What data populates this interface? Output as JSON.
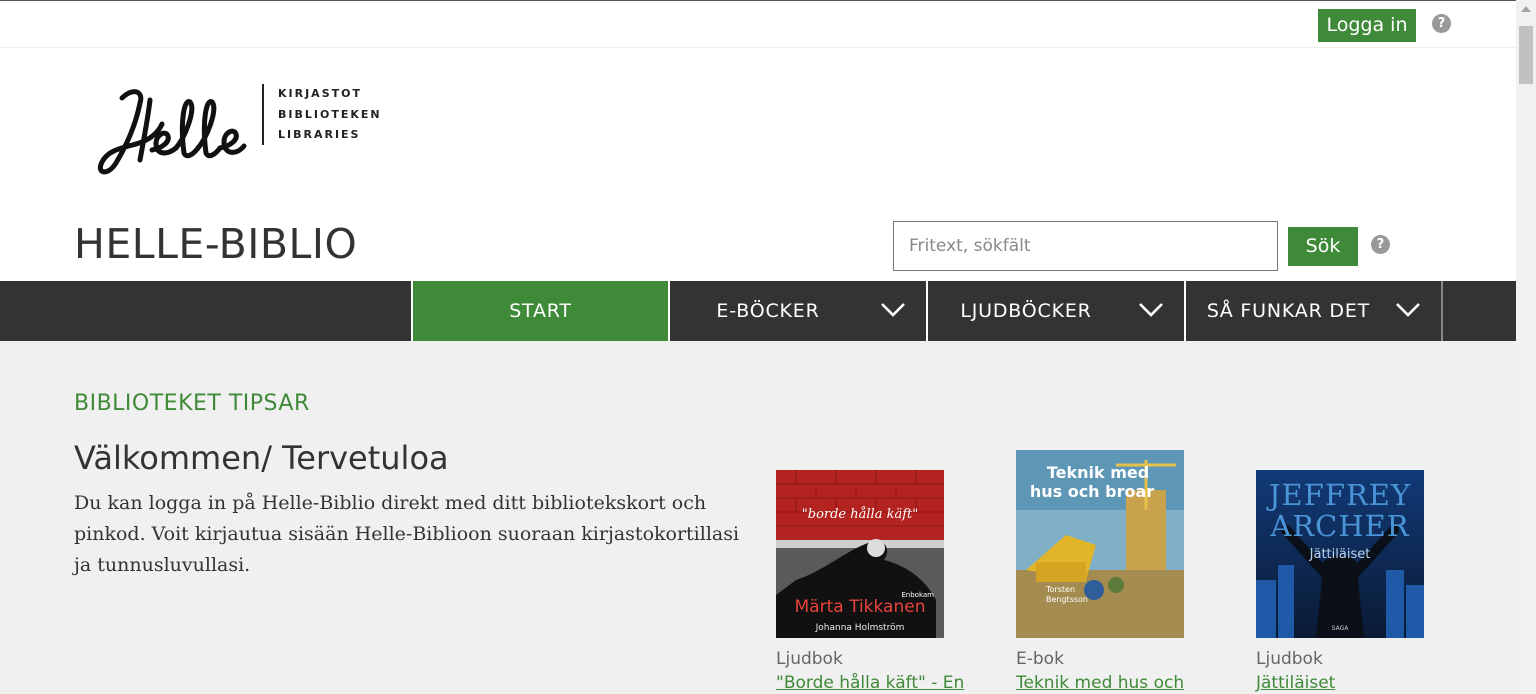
{
  "topbar": {
    "login_label": "Logga in",
    "help_glyph": "?"
  },
  "header": {
    "logo_script": "Helle",
    "logo_lines": [
      "KIRJASTOT",
      "BIBLIOTEKEN",
      "LIBRARIES"
    ],
    "site_title": "HELLE-BIBLIO"
  },
  "search": {
    "placeholder": "Fritext, sökfält",
    "value": "",
    "button_label": "Sök",
    "help_glyph": "?"
  },
  "nav": {
    "items": [
      {
        "label": "START",
        "active": true,
        "dropdown": false
      },
      {
        "label": "E-BÖCKER",
        "active": false,
        "dropdown": true
      },
      {
        "label": "LJUDBÖCKER",
        "active": false,
        "dropdown": true
      },
      {
        "label": "SÅ FUNKAR DET",
        "active": false,
        "dropdown": true
      }
    ]
  },
  "main": {
    "section_title": "BIBLIOTEKET TIPSAR",
    "welcome_title": "Välkommen/ Tervetuloa",
    "welcome_text": "Du kan logga in på Helle-Biblio direkt med ditt bibliotekskort och pinkod. Voit kirjautua sisään Helle-Biblioon suoraan kirjastokortillasi ja tunnusluvullasi."
  },
  "books": [
    {
      "type": "Ljudbok",
      "title": "\"Borde hålla käft\" - En",
      "cover_text": {
        "quote": "\"borde hålla käft\"",
        "subtitle": "Enbokam",
        "author_big": "Märta Tikkanen",
        "author_small": "Johanna Holmström"
      }
    },
    {
      "type": "E-bok",
      "title": "Teknik med hus och",
      "cover_text": {
        "title_line1": "Teknik med",
        "title_line2": "hus och broar",
        "author_line1": "Torsten",
        "author_line2": "Bengtsson"
      }
    },
    {
      "type": "Ljudbok",
      "title": "Jättiläiset",
      "cover_text": {
        "author_line1": "JEFFREY",
        "author_line2": "ARCHER",
        "title": "Jättiläiset",
        "publisher": "SAGA"
      }
    }
  ],
  "colors": {
    "accent_green": "#3f8a38",
    "nav_dark": "#333333",
    "main_bg": "#f0f0f0"
  }
}
